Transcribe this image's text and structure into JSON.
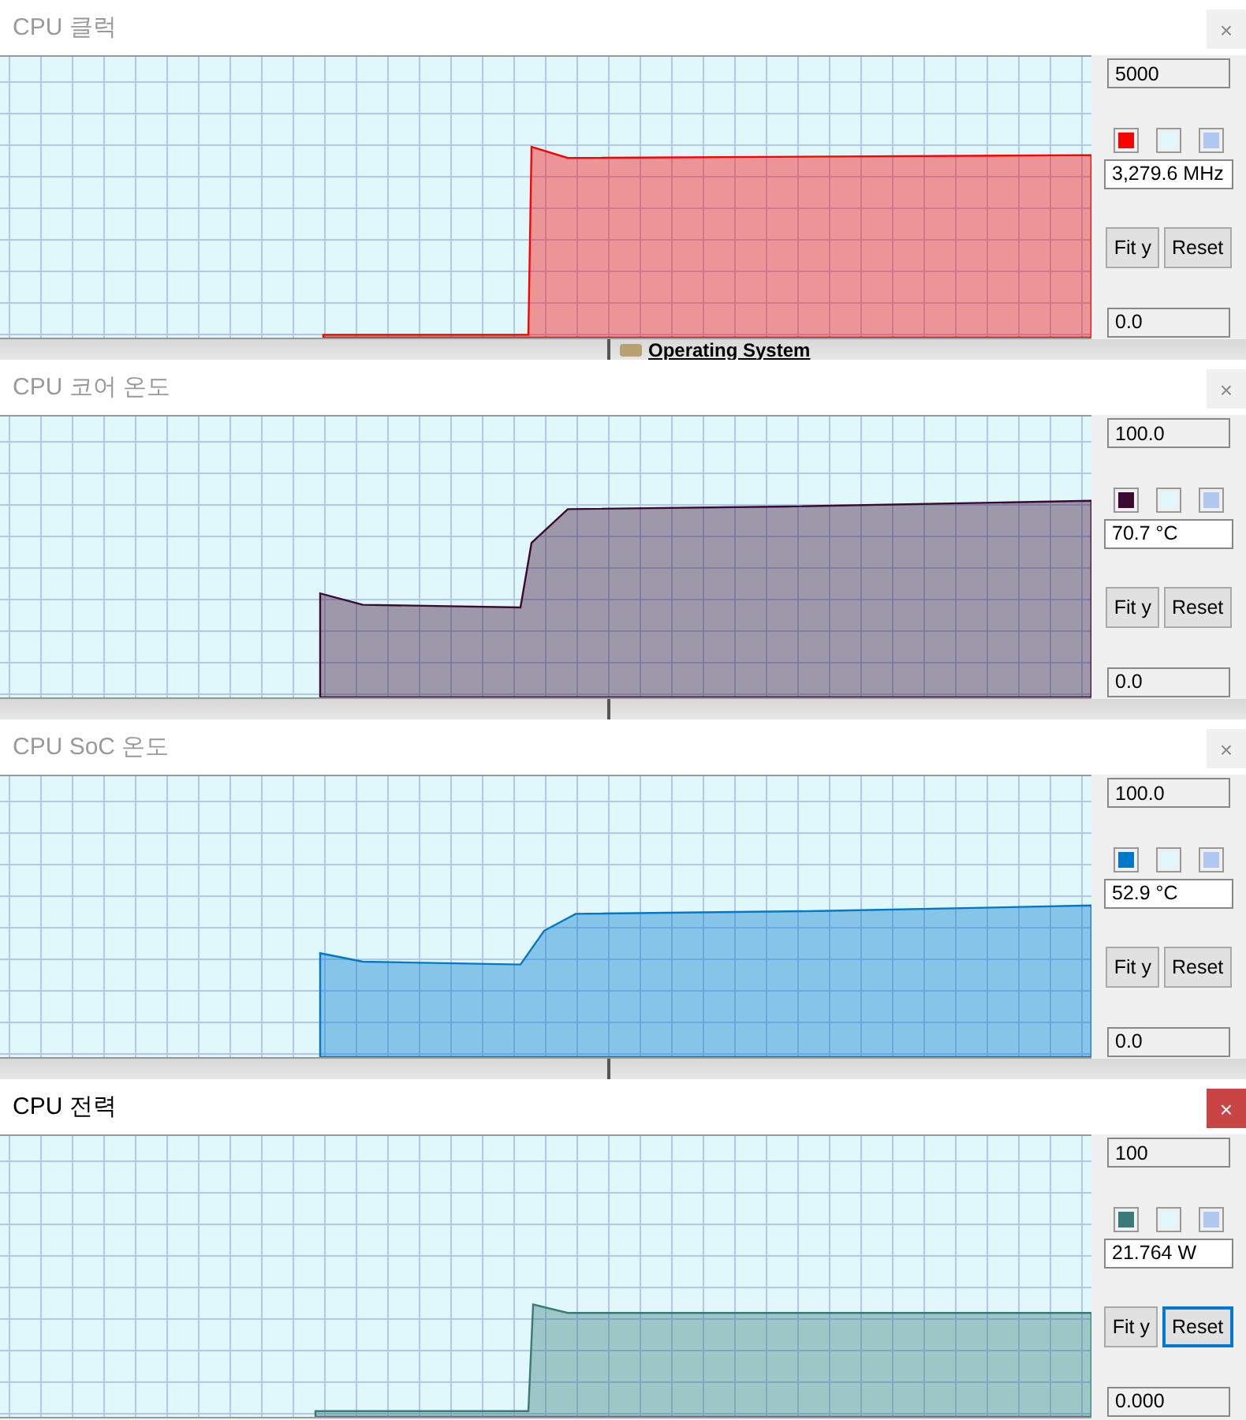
{
  "windows": [
    {
      "title": "CPU 클럭",
      "active": false,
      "close": "×",
      "max": "5000",
      "reading": "3,279.6 MHz",
      "min": "0.0",
      "buttons": [
        "Fit y",
        "Reset"
      ],
      "swatches": [
        {
          "color": "#ff0000"
        },
        {
          "color": "#e0f8fc"
        },
        {
          "color": "#b0c8f0"
        }
      ]
    },
    {
      "title": "CPU 코어 온도",
      "active": false,
      "close": "×",
      "max": "100.0",
      "reading": "70.7 °C",
      "min": "0.0",
      "buttons": [
        "Fit y",
        "Reset"
      ],
      "swatches": [
        {
          "color": "#3c0a30"
        },
        {
          "color": "#e0f8fc"
        },
        {
          "color": "#b0c8f0"
        }
      ]
    },
    {
      "title": "CPU SoC 온도",
      "active": false,
      "close": "×",
      "max": "100.0",
      "reading": "52.9 °C",
      "min": "0.0",
      "buttons": [
        "Fit y",
        "Reset"
      ],
      "swatches": [
        {
          "color": "#0078c8"
        },
        {
          "color": "#e0f8fc"
        },
        {
          "color": "#b0c8f0"
        }
      ]
    },
    {
      "title": "CPU 전력",
      "active": true,
      "close": "×",
      "max": "100",
      "reading": "21.764 W",
      "min": "0.000",
      "buttons": [
        "Fit y",
        "Reset"
      ],
      "swatches": [
        {
          "color": "#3a7a78"
        },
        {
          "color": "#e0f8fc"
        },
        {
          "color": "#b0c8f0"
        }
      ]
    }
  ],
  "background_window": {
    "link": "Operating System"
  }
}
